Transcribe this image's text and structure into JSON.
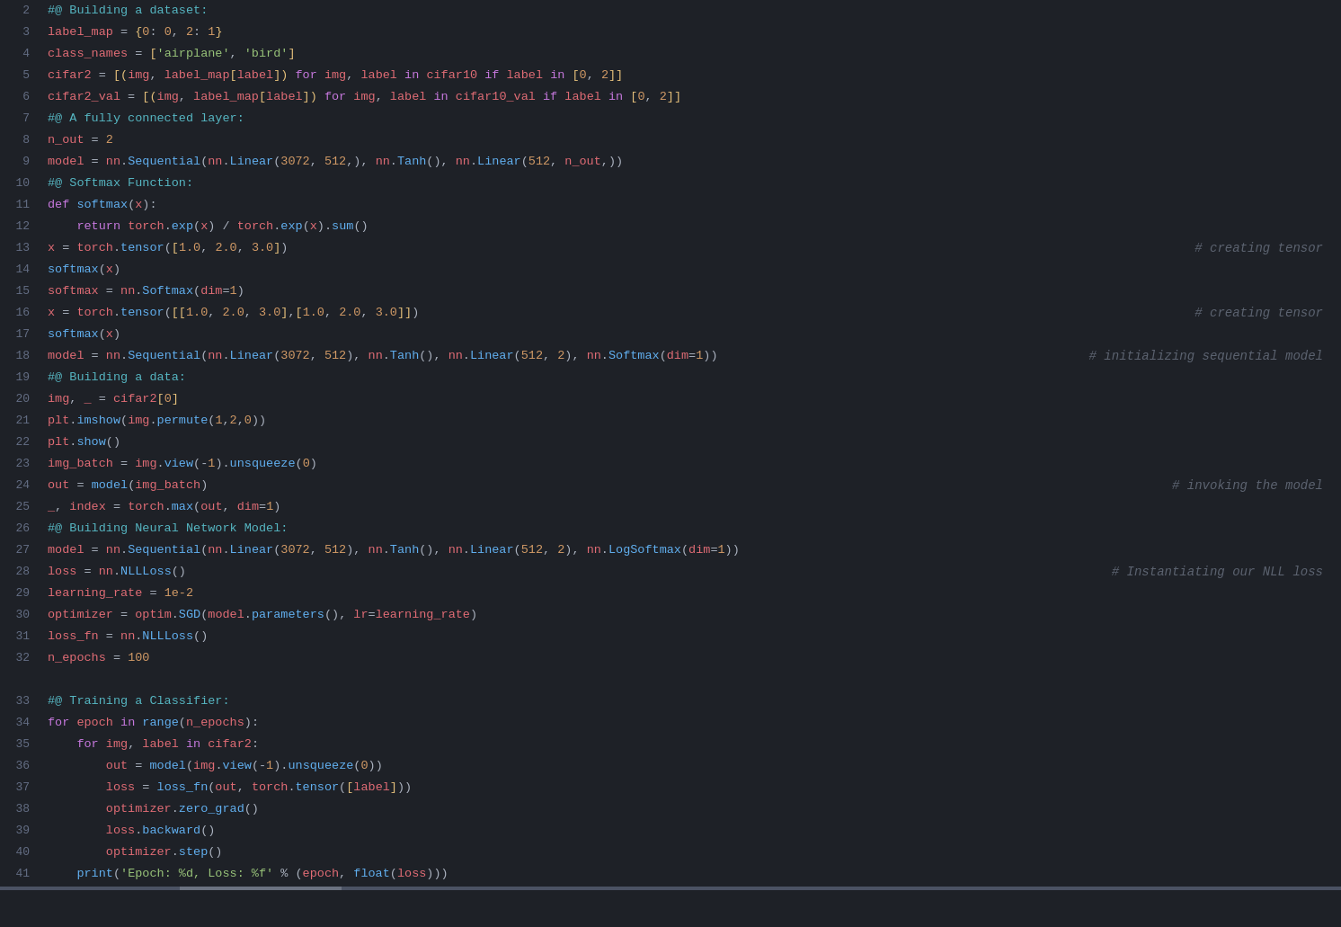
{
  "editor": {
    "background": "#1e2127",
    "lines": [
      {
        "num": 2,
        "content": "#@ Building a dataset:",
        "type": "section"
      },
      {
        "num": 3,
        "content": "label_map = {0: 0, 2: 1}",
        "type": "code"
      },
      {
        "num": 4,
        "content": "class_names = ['airplane', 'bird']",
        "type": "code"
      },
      {
        "num": 5,
        "content": "cifar2 = [(img, label_map[label]) for img, label in cifar10 if label in [0, 2]]",
        "type": "code"
      },
      {
        "num": 6,
        "content": "cifar2_val = [(img, label_map[label]) for img, label in cifar10_val if label in [0, 2]]",
        "type": "code"
      },
      {
        "num": 7,
        "content": "#@ A fully connected layer:",
        "type": "section"
      },
      {
        "num": 8,
        "content": "n_out = 2",
        "type": "code"
      },
      {
        "num": 9,
        "content": "model = nn.Sequential(nn.Linear(3072, 512,), nn.Tanh(), nn.Linear(512, n_out,))",
        "type": "code"
      },
      {
        "num": 10,
        "content": "#@ Softmax Function:",
        "type": "section"
      },
      {
        "num": 11,
        "content": "def softmax(x):",
        "type": "code"
      },
      {
        "num": 12,
        "content": "    return torch.exp(x) / torch.exp(x).sum()",
        "type": "code"
      },
      {
        "num": 13,
        "content": "x = torch.tensor([1.0, 2.0, 3.0])",
        "type": "code",
        "comment": "# creating tensor"
      },
      {
        "num": 14,
        "content": "softmax(x)",
        "type": "code"
      },
      {
        "num": 15,
        "content": "softmax = nn.Softmax(dim=1)",
        "type": "code"
      },
      {
        "num": 16,
        "content": "x = torch.tensor([[1.0, 2.0, 3.0],[1.0, 2.0, 3.0]])",
        "type": "code",
        "comment": "# creating tensor"
      },
      {
        "num": 17,
        "content": "softmax(x)",
        "type": "code"
      },
      {
        "num": 18,
        "content": "model = nn.Sequential(nn.Linear(3072, 512), nn.Tanh(), nn.Linear(512, 2), nn.Softmax(dim=1))",
        "type": "code",
        "comment": "# initializing sequential model"
      },
      {
        "num": 19,
        "content": "#@ Building a data:",
        "type": "section"
      },
      {
        "num": 20,
        "content": "img, _ = cifar2[0]",
        "type": "code"
      },
      {
        "num": 21,
        "content": "plt.imshow(img.permute(1,2,0))",
        "type": "code"
      },
      {
        "num": 22,
        "content": "plt.show()",
        "type": "code"
      },
      {
        "num": 23,
        "content": "img_batch = img.view(-1).unsqueeze(0)",
        "type": "code"
      },
      {
        "num": 24,
        "content": "out = model(img_batch)",
        "type": "code",
        "comment": "# invoking the model"
      },
      {
        "num": 25,
        "content": "_, index = torch.max(out, dim=1)",
        "type": "code"
      },
      {
        "num": 26,
        "content": "#@ Building Neural Network Model:",
        "type": "section"
      },
      {
        "num": 27,
        "content": "model = nn.Sequential(nn.Linear(3072, 512), nn.Tanh(), nn.Linear(512, 2), nn.LogSoftmax(dim=1))",
        "type": "code"
      },
      {
        "num": 28,
        "content": "loss = nn.NLLLoss()",
        "type": "code",
        "comment": "# Instantiating our NLL loss"
      },
      {
        "num": 29,
        "content": "learning_rate = 1e-2",
        "type": "code"
      },
      {
        "num": 30,
        "content": "optimizer = optim.SGD(model.parameters(), lr=learning_rate)",
        "type": "code"
      },
      {
        "num": 31,
        "content": "loss_fn = nn.NLLLoss()",
        "type": "code"
      },
      {
        "num": 32,
        "content": "n_epochs = 100",
        "type": "code"
      },
      {
        "num": 33,
        "content": "#@ Training a Classifier:",
        "type": "section"
      },
      {
        "num": 34,
        "content": "for epoch in range(n_epochs):",
        "type": "code"
      },
      {
        "num": 35,
        "content": "    for img, label in cifar2:",
        "type": "code"
      },
      {
        "num": 36,
        "content": "        out = model(img.view(-1).unsqueeze(0))",
        "type": "code"
      },
      {
        "num": 37,
        "content": "        loss = loss_fn(out, torch.tensor([label]))",
        "type": "code"
      },
      {
        "num": 38,
        "content": "        optimizer.zero_grad()",
        "type": "code"
      },
      {
        "num": 39,
        "content": "        loss.backward()",
        "type": "code"
      },
      {
        "num": 40,
        "content": "        optimizer.step()",
        "type": "code"
      },
      {
        "num": 41,
        "content": "    print('Epoch: %d, Loss: %f' % (epoch, float(loss)))",
        "type": "code"
      }
    ]
  }
}
